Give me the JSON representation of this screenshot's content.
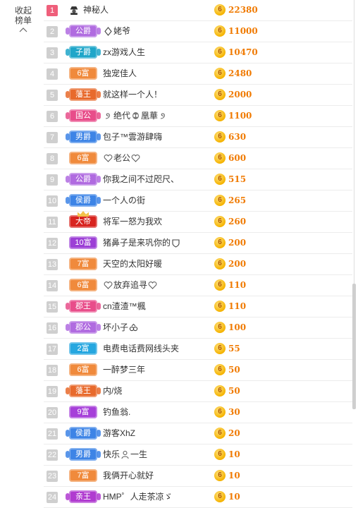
{
  "sidebar": {
    "collapse_label": "收起\n榜单",
    "collapse_line1": "收起",
    "collapse_line2": "榜单"
  },
  "currency_glyph": "6",
  "ranking": [
    {
      "rank": "1",
      "badge": "",
      "badge_color": "",
      "name": "神秘人",
      "score": "22380",
      "avatar": "spy-avatar-icon"
    },
    {
      "rank": "2",
      "badge": "公爵",
      "badge_color": "#b06be0",
      "name": "姥爷",
      "score": "11000",
      "name_icon": "diamond-suit-icon"
    },
    {
      "rank": "3",
      "badge": "子爵",
      "badge_color": "#1fa6c9",
      "name": "zx游戏人生",
      "score": "10470"
    },
    {
      "rank": "4",
      "badge": "6富",
      "badge_color": "#f08a3c",
      "name": "独宠佳人",
      "score": "2480"
    },
    {
      "rank": "5",
      "badge": "藩王",
      "badge_color": "#e86a2c",
      "name": "就这样一个人！",
      "score": "2000"
    },
    {
      "rank": "6",
      "badge": "国公",
      "badge_color": "#e84d8a",
      "name": "绝代",
      "name2": "凰華",
      "score": "1100",
      "name_icon": "swirl-icon",
      "name_mid_icon": "alien-icon",
      "name_end_icon": "swirl-icon"
    },
    {
      "rank": "7",
      "badge": "男爵",
      "badge_color": "#3d84e6",
      "name": "包子™雲游肆嗨",
      "score": "630"
    },
    {
      "rank": "8",
      "badge": "6富",
      "badge_color": "#f08a3c",
      "name": "老公",
      "score": "600",
      "name_icon": "heart-icon",
      "name_end_icon": "heart-icon"
    },
    {
      "rank": "9",
      "badge": "公爵",
      "badge_color": "#b06be0",
      "name": "你我之间不过咫尺、",
      "score": "515"
    },
    {
      "rank": "10",
      "badge": "侯爵",
      "badge_color": "#3d84e6",
      "name": "一个人の街",
      "score": "265"
    },
    {
      "rank": "11",
      "badge": "大帝",
      "badge_color": "#d8241f",
      "name": "将军一怒为我欢",
      "score": "260"
    },
    {
      "rank": "12",
      "badge": "10富",
      "badge_color": "#9c3fd6",
      "name": "猪鼻子是来巩你的",
      "score": "200",
      "name_end_icon": "shield-icon"
    },
    {
      "rank": "13",
      "badge": "7富",
      "badge_color": "#f08a3c",
      "name": "天空的太阳好暖",
      "score": "200"
    },
    {
      "rank": "14",
      "badge": "6富",
      "badge_color": "#f08a3c",
      "name": "放弃追寻",
      "score": "110",
      "name_icon": "heart-icon",
      "name_end_icon": "heart-icon"
    },
    {
      "rank": "15",
      "badge": "郡王",
      "badge_color": "#e84d8a",
      "name": "cn渣渣™楓",
      "score": "110"
    },
    {
      "rank": "16",
      "badge": "郡公",
      "badge_color": "#b06be0",
      "name": "坏小子",
      "score": "100",
      "name_end_icon": "goggles-icon"
    },
    {
      "rank": "17",
      "badge": "2富",
      "badge_color": "#26a7e0",
      "name": "电费电话费网线头夹",
      "score": "55"
    },
    {
      "rank": "18",
      "badge": "6富",
      "badge_color": "#f08a3c",
      "name": "一醉梦三年",
      "score": "50"
    },
    {
      "rank": "19",
      "badge": "藩王",
      "badge_color": "#e86a2c",
      "name": "内/烧",
      "score": "50"
    },
    {
      "rank": "20",
      "badge": "9富",
      "badge_color": "#a63fd9",
      "name": "钓鱼翁.",
      "score": "30"
    },
    {
      "rank": "21",
      "badge": "侯爵",
      "badge_color": "#3d84e6",
      "name": "游客XhZ",
      "score": "20"
    },
    {
      "rank": "22",
      "badge": "男爵",
      "badge_color": "#3d84e6",
      "name": "快乐",
      "name2": "一生",
      "score": "10",
      "name_mid_icon": "person-icon"
    },
    {
      "rank": "23",
      "badge": "7富",
      "badge_color": "#f08a3c",
      "name": "我俩开心就好",
      "score": "10"
    },
    {
      "rank": "24",
      "badge": "亲王",
      "badge_color": "#b03bd0",
      "name": "HMP゜人走茶凉ゞ",
      "score": "10"
    }
  ]
}
